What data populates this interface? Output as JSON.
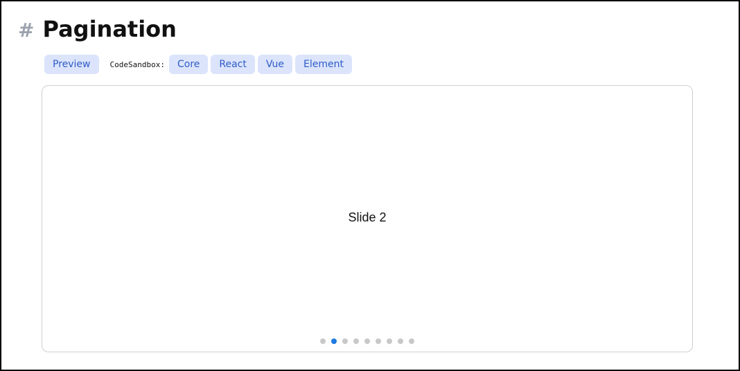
{
  "heading": {
    "hash": "#",
    "title": "Pagination"
  },
  "toolbar": {
    "preview_label": "Preview",
    "codesandbox_label": "CodeSandbox:",
    "buttons": [
      "Core",
      "React",
      "Vue",
      "Element"
    ]
  },
  "slider": {
    "slide_text": "Slide 2",
    "active_index": 1,
    "total": 9
  },
  "colors": {
    "button_bg": "#dbe4fb",
    "button_text": "#2f5cc8",
    "dot_active": "#1e7be0",
    "dot_inactive": "#c8c8c8"
  }
}
